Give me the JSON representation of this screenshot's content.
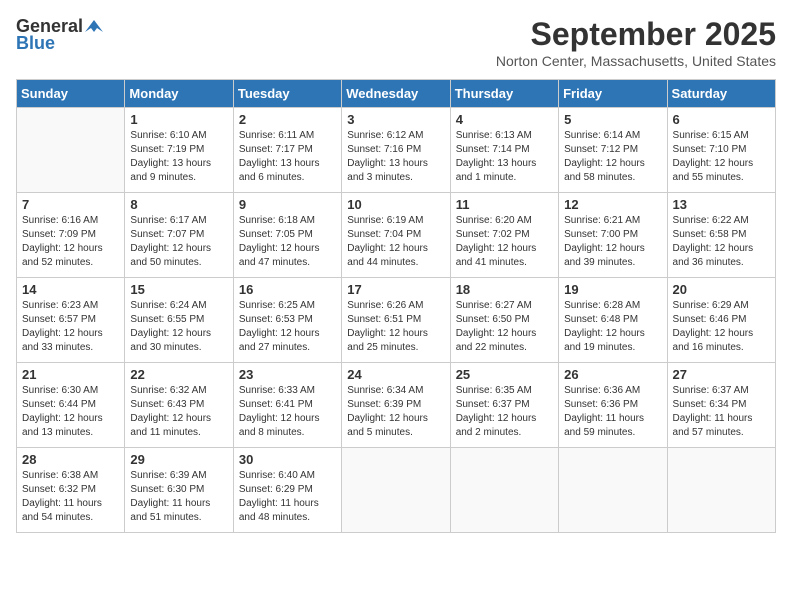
{
  "header": {
    "logo_general": "General",
    "logo_blue": "Blue",
    "month_title": "September 2025",
    "location": "Norton Center, Massachusetts, United States"
  },
  "columns": [
    "Sunday",
    "Monday",
    "Tuesday",
    "Wednesday",
    "Thursday",
    "Friday",
    "Saturday"
  ],
  "weeks": [
    [
      {
        "day": "",
        "sunrise": "",
        "sunset": "",
        "daylight": ""
      },
      {
        "day": "1",
        "sunrise": "Sunrise: 6:10 AM",
        "sunset": "Sunset: 7:19 PM",
        "daylight": "Daylight: 13 hours and 9 minutes."
      },
      {
        "day": "2",
        "sunrise": "Sunrise: 6:11 AM",
        "sunset": "Sunset: 7:17 PM",
        "daylight": "Daylight: 13 hours and 6 minutes."
      },
      {
        "day": "3",
        "sunrise": "Sunrise: 6:12 AM",
        "sunset": "Sunset: 7:16 PM",
        "daylight": "Daylight: 13 hours and 3 minutes."
      },
      {
        "day": "4",
        "sunrise": "Sunrise: 6:13 AM",
        "sunset": "Sunset: 7:14 PM",
        "daylight": "Daylight: 13 hours and 1 minute."
      },
      {
        "day": "5",
        "sunrise": "Sunrise: 6:14 AM",
        "sunset": "Sunset: 7:12 PM",
        "daylight": "Daylight: 12 hours and 58 minutes."
      },
      {
        "day": "6",
        "sunrise": "Sunrise: 6:15 AM",
        "sunset": "Sunset: 7:10 PM",
        "daylight": "Daylight: 12 hours and 55 minutes."
      }
    ],
    [
      {
        "day": "7",
        "sunrise": "Sunrise: 6:16 AM",
        "sunset": "Sunset: 7:09 PM",
        "daylight": "Daylight: 12 hours and 52 minutes."
      },
      {
        "day": "8",
        "sunrise": "Sunrise: 6:17 AM",
        "sunset": "Sunset: 7:07 PM",
        "daylight": "Daylight: 12 hours and 50 minutes."
      },
      {
        "day": "9",
        "sunrise": "Sunrise: 6:18 AM",
        "sunset": "Sunset: 7:05 PM",
        "daylight": "Daylight: 12 hours and 47 minutes."
      },
      {
        "day": "10",
        "sunrise": "Sunrise: 6:19 AM",
        "sunset": "Sunset: 7:04 PM",
        "daylight": "Daylight: 12 hours and 44 minutes."
      },
      {
        "day": "11",
        "sunrise": "Sunrise: 6:20 AM",
        "sunset": "Sunset: 7:02 PM",
        "daylight": "Daylight: 12 hours and 41 minutes."
      },
      {
        "day": "12",
        "sunrise": "Sunrise: 6:21 AM",
        "sunset": "Sunset: 7:00 PM",
        "daylight": "Daylight: 12 hours and 39 minutes."
      },
      {
        "day": "13",
        "sunrise": "Sunrise: 6:22 AM",
        "sunset": "Sunset: 6:58 PM",
        "daylight": "Daylight: 12 hours and 36 minutes."
      }
    ],
    [
      {
        "day": "14",
        "sunrise": "Sunrise: 6:23 AM",
        "sunset": "Sunset: 6:57 PM",
        "daylight": "Daylight: 12 hours and 33 minutes."
      },
      {
        "day": "15",
        "sunrise": "Sunrise: 6:24 AM",
        "sunset": "Sunset: 6:55 PM",
        "daylight": "Daylight: 12 hours and 30 minutes."
      },
      {
        "day": "16",
        "sunrise": "Sunrise: 6:25 AM",
        "sunset": "Sunset: 6:53 PM",
        "daylight": "Daylight: 12 hours and 27 minutes."
      },
      {
        "day": "17",
        "sunrise": "Sunrise: 6:26 AM",
        "sunset": "Sunset: 6:51 PM",
        "daylight": "Daylight: 12 hours and 25 minutes."
      },
      {
        "day": "18",
        "sunrise": "Sunrise: 6:27 AM",
        "sunset": "Sunset: 6:50 PM",
        "daylight": "Daylight: 12 hours and 22 minutes."
      },
      {
        "day": "19",
        "sunrise": "Sunrise: 6:28 AM",
        "sunset": "Sunset: 6:48 PM",
        "daylight": "Daylight: 12 hours and 19 minutes."
      },
      {
        "day": "20",
        "sunrise": "Sunrise: 6:29 AM",
        "sunset": "Sunset: 6:46 PM",
        "daylight": "Daylight: 12 hours and 16 minutes."
      }
    ],
    [
      {
        "day": "21",
        "sunrise": "Sunrise: 6:30 AM",
        "sunset": "Sunset: 6:44 PM",
        "daylight": "Daylight: 12 hours and 13 minutes."
      },
      {
        "day": "22",
        "sunrise": "Sunrise: 6:32 AM",
        "sunset": "Sunset: 6:43 PM",
        "daylight": "Daylight: 12 hours and 11 minutes."
      },
      {
        "day": "23",
        "sunrise": "Sunrise: 6:33 AM",
        "sunset": "Sunset: 6:41 PM",
        "daylight": "Daylight: 12 hours and 8 minutes."
      },
      {
        "day": "24",
        "sunrise": "Sunrise: 6:34 AM",
        "sunset": "Sunset: 6:39 PM",
        "daylight": "Daylight: 12 hours and 5 minutes."
      },
      {
        "day": "25",
        "sunrise": "Sunrise: 6:35 AM",
        "sunset": "Sunset: 6:37 PM",
        "daylight": "Daylight: 12 hours and 2 minutes."
      },
      {
        "day": "26",
        "sunrise": "Sunrise: 6:36 AM",
        "sunset": "Sunset: 6:36 PM",
        "daylight": "Daylight: 11 hours and 59 minutes."
      },
      {
        "day": "27",
        "sunrise": "Sunrise: 6:37 AM",
        "sunset": "Sunset: 6:34 PM",
        "daylight": "Daylight: 11 hours and 57 minutes."
      }
    ],
    [
      {
        "day": "28",
        "sunrise": "Sunrise: 6:38 AM",
        "sunset": "Sunset: 6:32 PM",
        "daylight": "Daylight: 11 hours and 54 minutes."
      },
      {
        "day": "29",
        "sunrise": "Sunrise: 6:39 AM",
        "sunset": "Sunset: 6:30 PM",
        "daylight": "Daylight: 11 hours and 51 minutes."
      },
      {
        "day": "30",
        "sunrise": "Sunrise: 6:40 AM",
        "sunset": "Sunset: 6:29 PM",
        "daylight": "Daylight: 11 hours and 48 minutes."
      },
      {
        "day": "",
        "sunrise": "",
        "sunset": "",
        "daylight": ""
      },
      {
        "day": "",
        "sunrise": "",
        "sunset": "",
        "daylight": ""
      },
      {
        "day": "",
        "sunrise": "",
        "sunset": "",
        "daylight": ""
      },
      {
        "day": "",
        "sunrise": "",
        "sunset": "",
        "daylight": ""
      }
    ]
  ]
}
